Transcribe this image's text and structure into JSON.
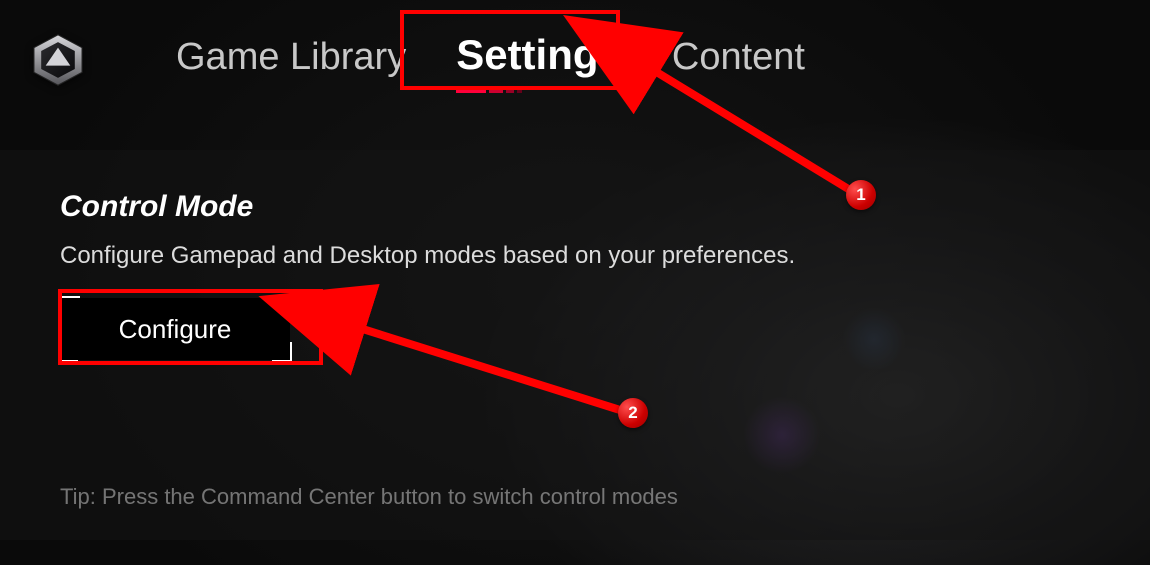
{
  "nav": {
    "items": [
      {
        "id": "library",
        "label": "Game Library",
        "active": false
      },
      {
        "id": "settings",
        "label": "Settings",
        "active": true
      },
      {
        "id": "content",
        "label": "Content",
        "active": false
      }
    ]
  },
  "panel": {
    "title": "Control Mode",
    "description": "Configure Gamepad and Desktop modes based on your preferences.",
    "button_label": "Configure",
    "tip": "Tip: Press the Command Center button to switch control modes"
  },
  "annotations": {
    "steps": [
      {
        "n": "1",
        "target": "settings-tab"
      },
      {
        "n": "2",
        "target": "configure-button"
      }
    ]
  },
  "colors": {
    "accent": "#ff003a",
    "highlight": "#ff0000",
    "badge": "#cc0000"
  }
}
